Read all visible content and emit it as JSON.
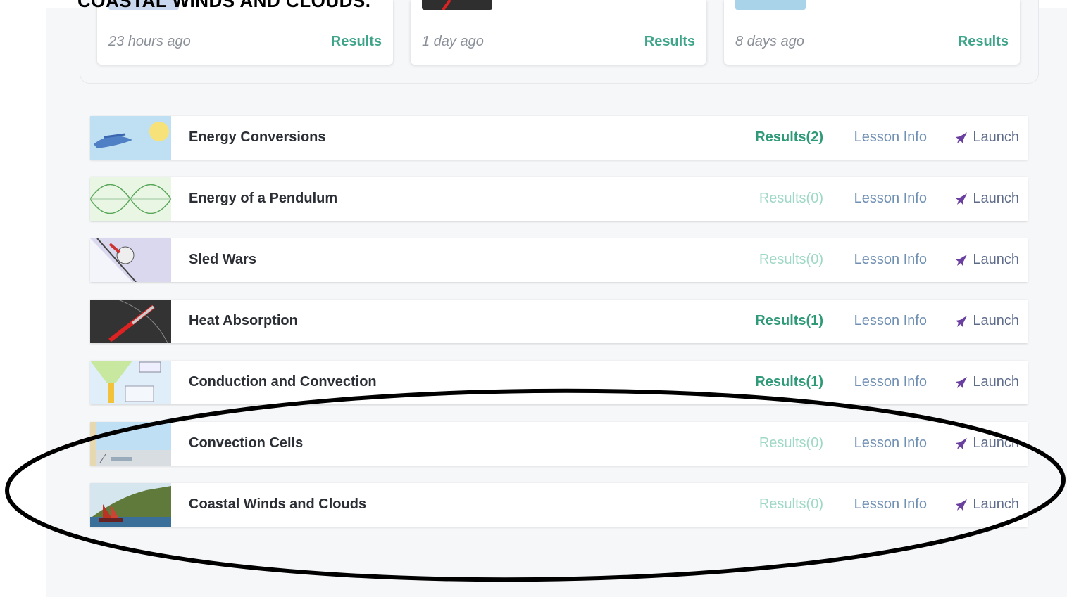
{
  "overlay_title": "COASTAL WINDS AND CLOUDS.",
  "recent": [
    {
      "time": "23 hours ago",
      "results_label": "Results",
      "thumb_color": "#c9d8ee"
    },
    {
      "time": "1 day ago",
      "results_label": "Results",
      "thumb_color": "#2f2f2f"
    },
    {
      "time": "8 days ago",
      "results_label": "Results",
      "thumb_color": "#a8d3e8"
    }
  ],
  "lessons": [
    {
      "title": "Energy Conversions",
      "results": "Results(2)",
      "results_active": true,
      "info": "Lesson Info",
      "launch": "Launch",
      "icon": "energy-conversions-thumbnail"
    },
    {
      "title": "Energy of a Pendulum",
      "results": "Results(0)",
      "results_active": false,
      "info": "Lesson Info",
      "launch": "Launch",
      "icon": "pendulum-thumbnail"
    },
    {
      "title": "Sled Wars",
      "results": "Results(0)",
      "results_active": false,
      "info": "Lesson Info",
      "launch": "Launch",
      "icon": "sled-wars-thumbnail"
    },
    {
      "title": "Heat Absorption",
      "results": "Results(1)",
      "results_active": true,
      "info": "Lesson Info",
      "launch": "Launch",
      "icon": "heat-absorption-thumbnail"
    },
    {
      "title": "Conduction and Convection",
      "results": "Results(1)",
      "results_active": true,
      "info": "Lesson Info",
      "launch": "Launch",
      "icon": "conduction-thumbnail"
    },
    {
      "title": "Convection Cells",
      "results": "Results(0)",
      "results_active": false,
      "info": "Lesson Info",
      "launch": "Launch",
      "icon": "convection-cells-thumbnail"
    },
    {
      "title": "Coastal Winds and Clouds",
      "results": "Results(0)",
      "results_active": false,
      "info": "Lesson Info",
      "launch": "Launch",
      "icon": "coastal-winds-thumbnail"
    }
  ],
  "colors": {
    "results_active": "#2f9a78",
    "results_inactive": "#9fd8c6",
    "lesson_info": "#6f8fb3",
    "launch": "#5d6b8a",
    "rocket": "#6a3fa0"
  }
}
